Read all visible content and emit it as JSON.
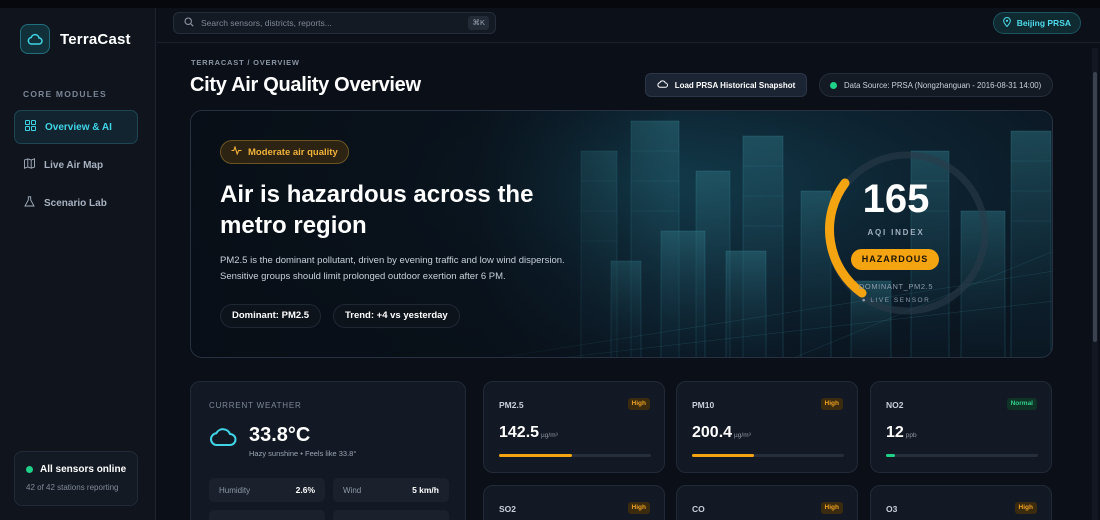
{
  "app": {
    "name": "TerraCast"
  },
  "sidebar": {
    "section_label": "CORE MODULES",
    "items": [
      {
        "label": "Overview & AI",
        "icon": "grid-icon",
        "active": true
      },
      {
        "label": "Live Air Map",
        "icon": "map-icon",
        "active": false
      },
      {
        "label": "Scenario Lab",
        "icon": "flask-icon",
        "active": false
      }
    ],
    "status": {
      "title": "All sensors online",
      "subtitle": "42 of 42 stations reporting"
    }
  },
  "header": {
    "search_placeholder": "Search sensors, districts, reports...",
    "search_shortcut": "⌘K",
    "location": "Beijing PRSA"
  },
  "page": {
    "breadcrumb": "TERRACAST / OVERVIEW",
    "title": "City Air Quality Overview",
    "load_button": "Load PRSA Historical Snapshot",
    "data_source": "Data Source: PRSA (Nongzhanguan - 2016-08-31 14:00)"
  },
  "hero": {
    "badge": "Moderate air quality",
    "headline": "Air is hazardous across the metro region",
    "description": "PM2.5 is the dominant pollutant, driven by evening traffic and low wind dispersion. Sensitive groups should limit prolonged outdoor exertion after 6 PM.",
    "chip_dominant": "Dominant: PM2.5",
    "chip_trend": "Trend: +4 vs yesterday",
    "aqi_value": "165",
    "aqi_label": "AQI INDEX",
    "aqi_status": "HAZARDOUS",
    "aqi_dominant": "DOMINANT_PM2.5",
    "aqi_live": "● LIVE SENSOR"
  },
  "weather": {
    "label": "CURRENT WEATHER",
    "temperature": "33.8°C",
    "summary": "Hazy sunshine • Feels like 33.8°",
    "humidity_label": "Humidity",
    "humidity_value": "2.6%",
    "wind_label": "Wind",
    "wind_value": "5 km/h"
  },
  "pollutants": [
    {
      "name": "PM2.5",
      "value": "142.5",
      "unit": "µg/m³",
      "status": "High",
      "level": 0.48
    },
    {
      "name": "PM10",
      "value": "200.4",
      "unit": "µg/m³",
      "status": "High",
      "level": 0.41
    },
    {
      "name": "NO2",
      "value": "12",
      "unit": "ppb",
      "status": "Normal",
      "level": 0.06
    },
    {
      "name": "SO2",
      "value": "",
      "unit": "",
      "status": "High",
      "level": null
    },
    {
      "name": "CO",
      "value": "",
      "unit": "",
      "status": "High",
      "level": null
    },
    {
      "name": "O3",
      "value": "",
      "unit": "",
      "status": "High",
      "level": null
    }
  ],
  "colors": {
    "accent": "#3fd4e6",
    "warning": "#f5a411",
    "success": "#1ed088",
    "background": "#0b0f17"
  }
}
